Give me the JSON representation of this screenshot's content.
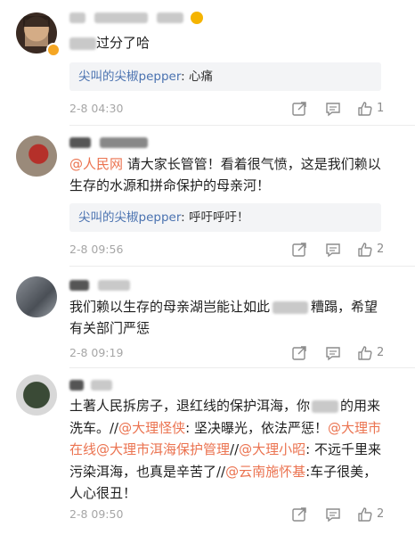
{
  "comments": [
    {
      "text_visible": "过分了哈",
      "reply": {
        "name": "尖叫的尖椒pepper",
        "sep": ": ",
        "text": "心痛"
      },
      "time": "2-8 04:30",
      "likes": "1"
    },
    {
      "text_mention": "@人民网",
      "text_rest": " 请大家长管管！看着很气愤，这是我们赖以生存的水源和拼命保护的母亲河！",
      "reply": {
        "name": "尖叫的尖椒pepper",
        "sep": ": ",
        "text": "呼吁呼吁！"
      },
      "time": "2-8 09:56",
      "likes": "2"
    },
    {
      "text_a": "我们赖以生存的母亲湖岂能让如此",
      "text_b": "糟蹋，希望有关部门严惩",
      "time": "2-8 09:19",
      "likes": "2"
    },
    {
      "text_a": "土著人民拆房子，退红线的保护洱海，你",
      "text_b": "的用来洗车。//",
      "m1": "@大理怪侠",
      "t1": ": 坚决曝光，依法严惩！",
      "m2": "@大理市在线",
      "m3": "@大理市洱海保护管理",
      "t2": "//",
      "m4": "@大理小昭",
      "t3": ": 不远千里来污染洱海，也真是辛苦了//",
      "m5": "@云南施怀基",
      "t4": ":车子很美，人心很丑！",
      "time": "2-8 09:50",
      "likes": "2"
    }
  ],
  "icons": {
    "share": "share-icon",
    "comment": "comment-icon",
    "like": "thumbs-up-icon"
  },
  "colors": {
    "mention": "#eb7350",
    "reply_name": "#4a72b0",
    "meta": "#a6a6a6",
    "reply_bg": "#f3f4f6"
  }
}
